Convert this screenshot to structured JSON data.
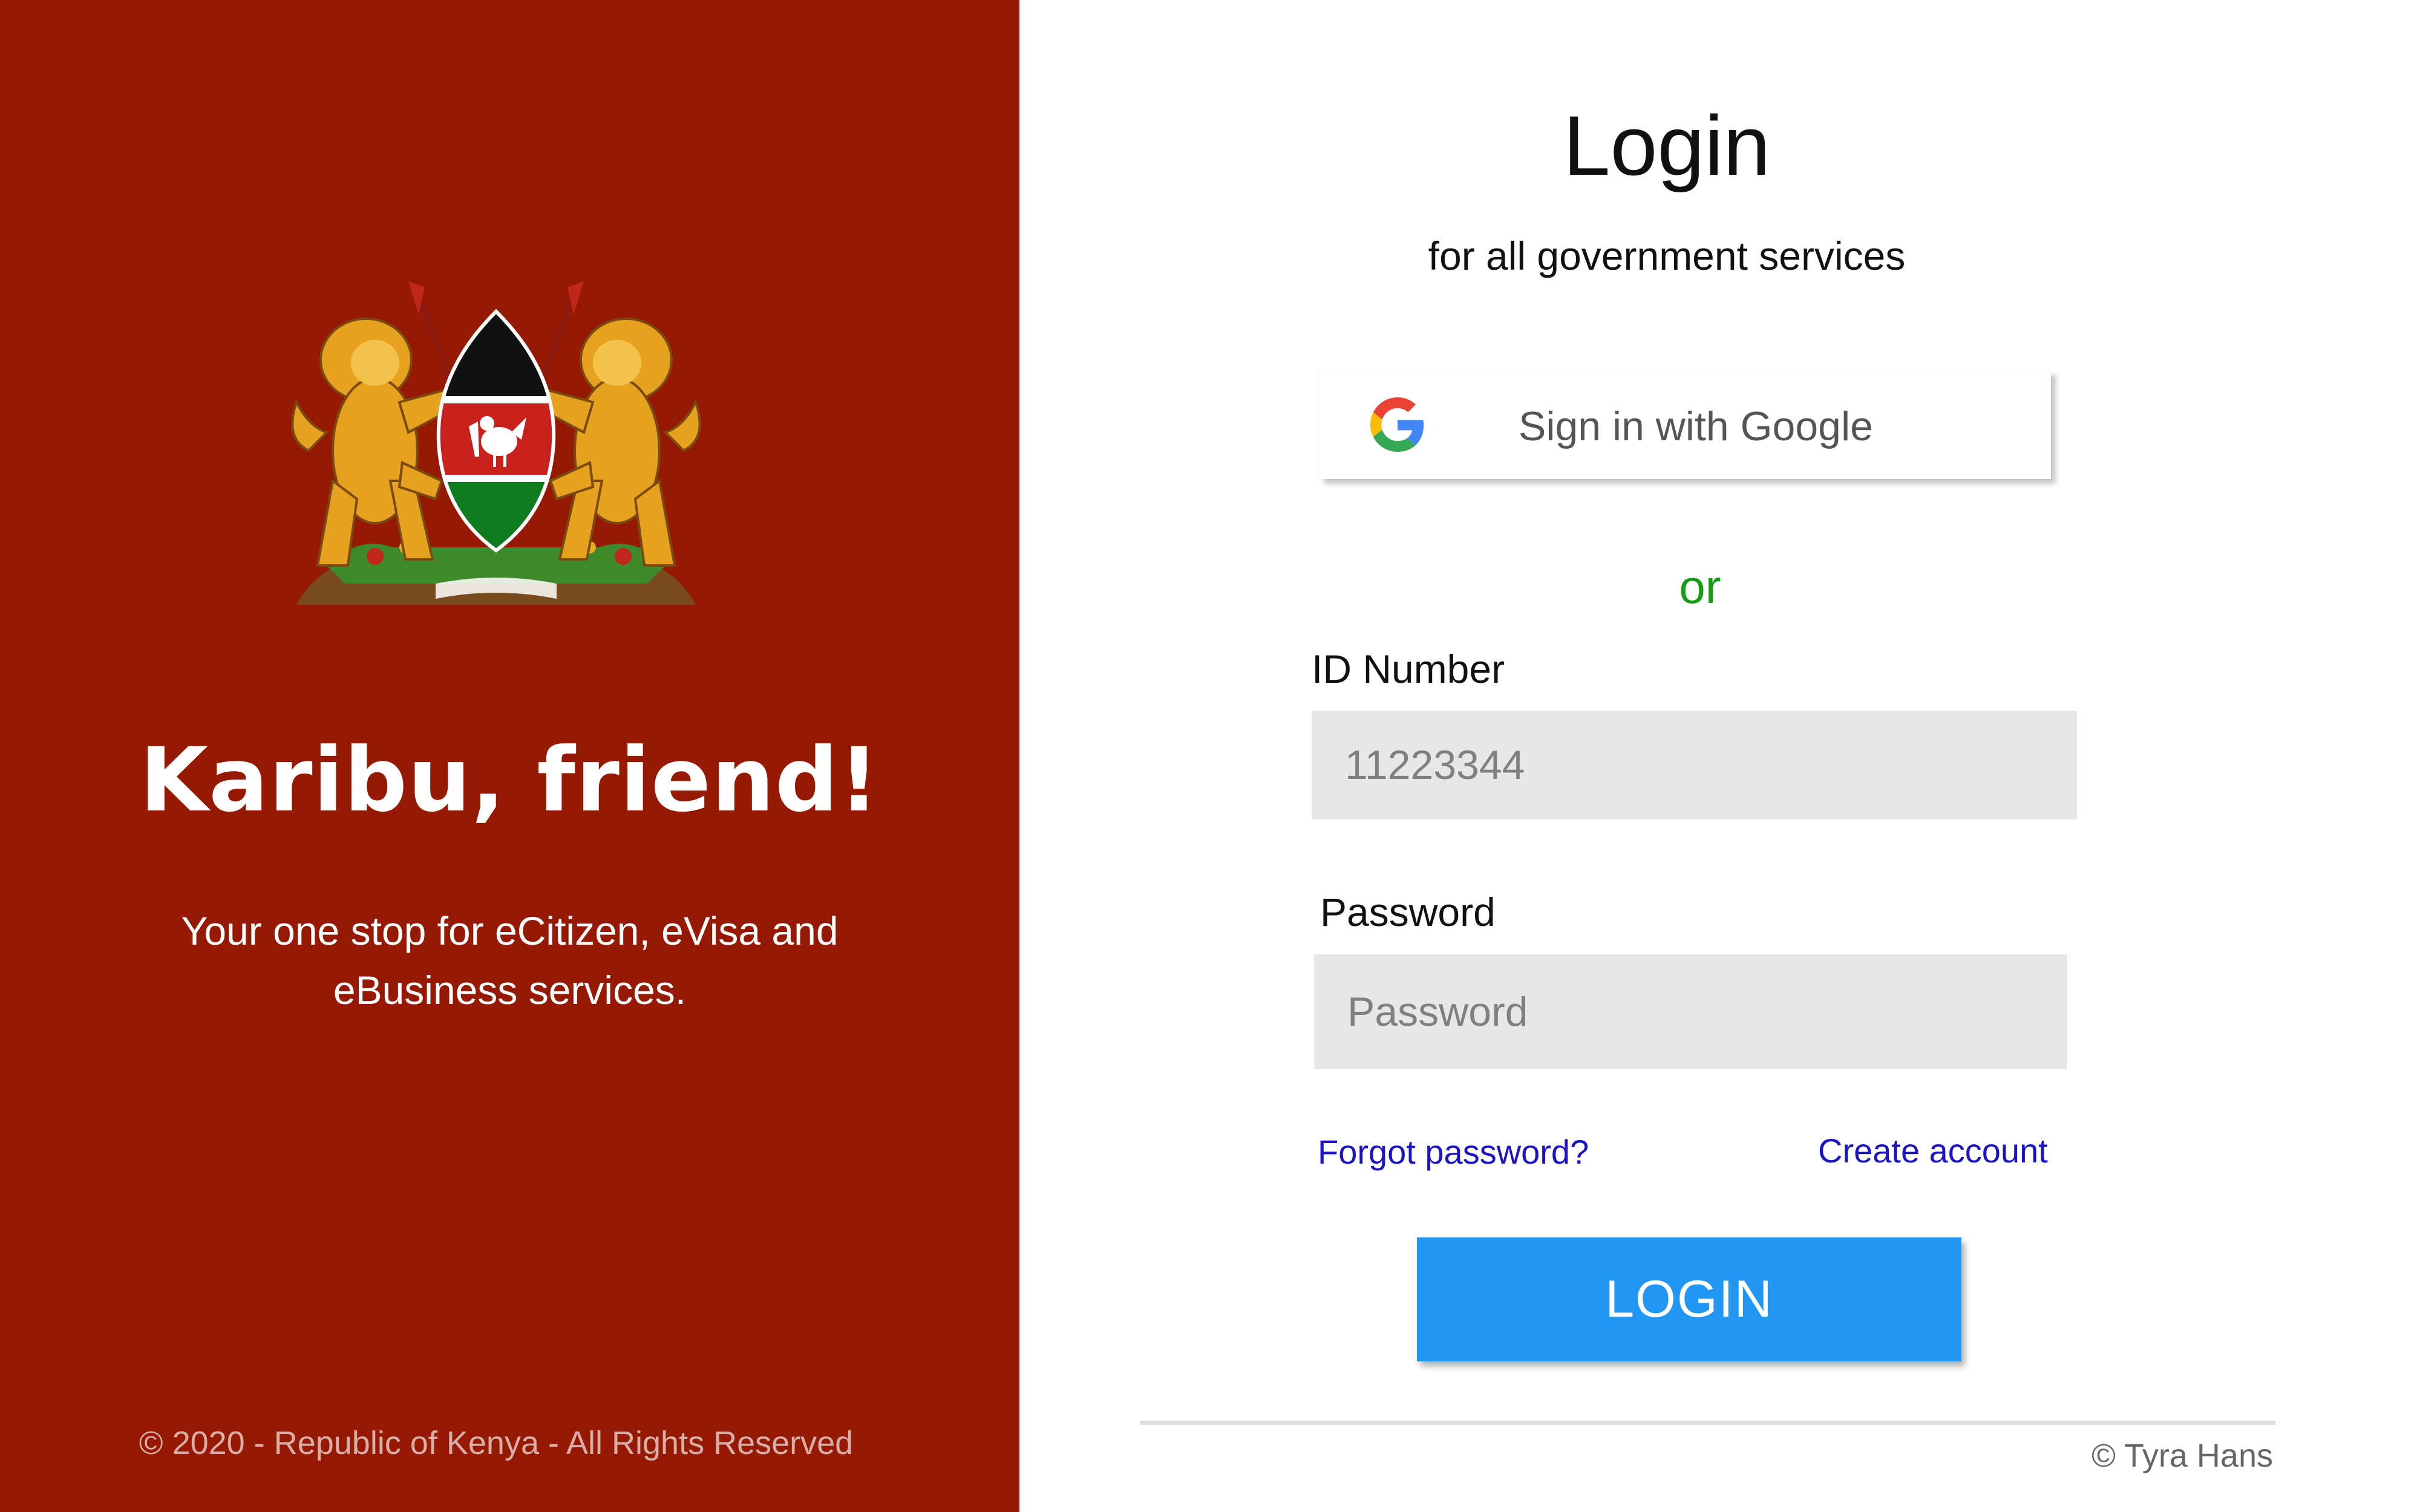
{
  "left_panel": {
    "background": "#961903",
    "emblem": "kenya-coat-of-arms",
    "title": "Karibu, friend!",
    "subtitle": "Your one stop for eCitizen, eVisa and eBusiness services.",
    "footer": "© 2020 - Republic of Kenya - All Rights Reserved"
  },
  "login_form": {
    "title": "Login",
    "subtitle": "for all government services",
    "google_button": {
      "label": "Sign in with Google",
      "icon": "google-g-icon"
    },
    "separator": "or",
    "id_field": {
      "label": "ID Number",
      "placeholder": "11223344",
      "value": ""
    },
    "password_field": {
      "label": "Password",
      "placeholder": "Password",
      "value": ""
    },
    "forgot_link": "Forgot password?",
    "create_link": "Create account",
    "submit_label": "LOGIN",
    "accent_color": "#2196f3",
    "link_color": "#1b14c4",
    "separator_color": "#179b16"
  },
  "footer": {
    "credit": "© Tyra Hans"
  }
}
